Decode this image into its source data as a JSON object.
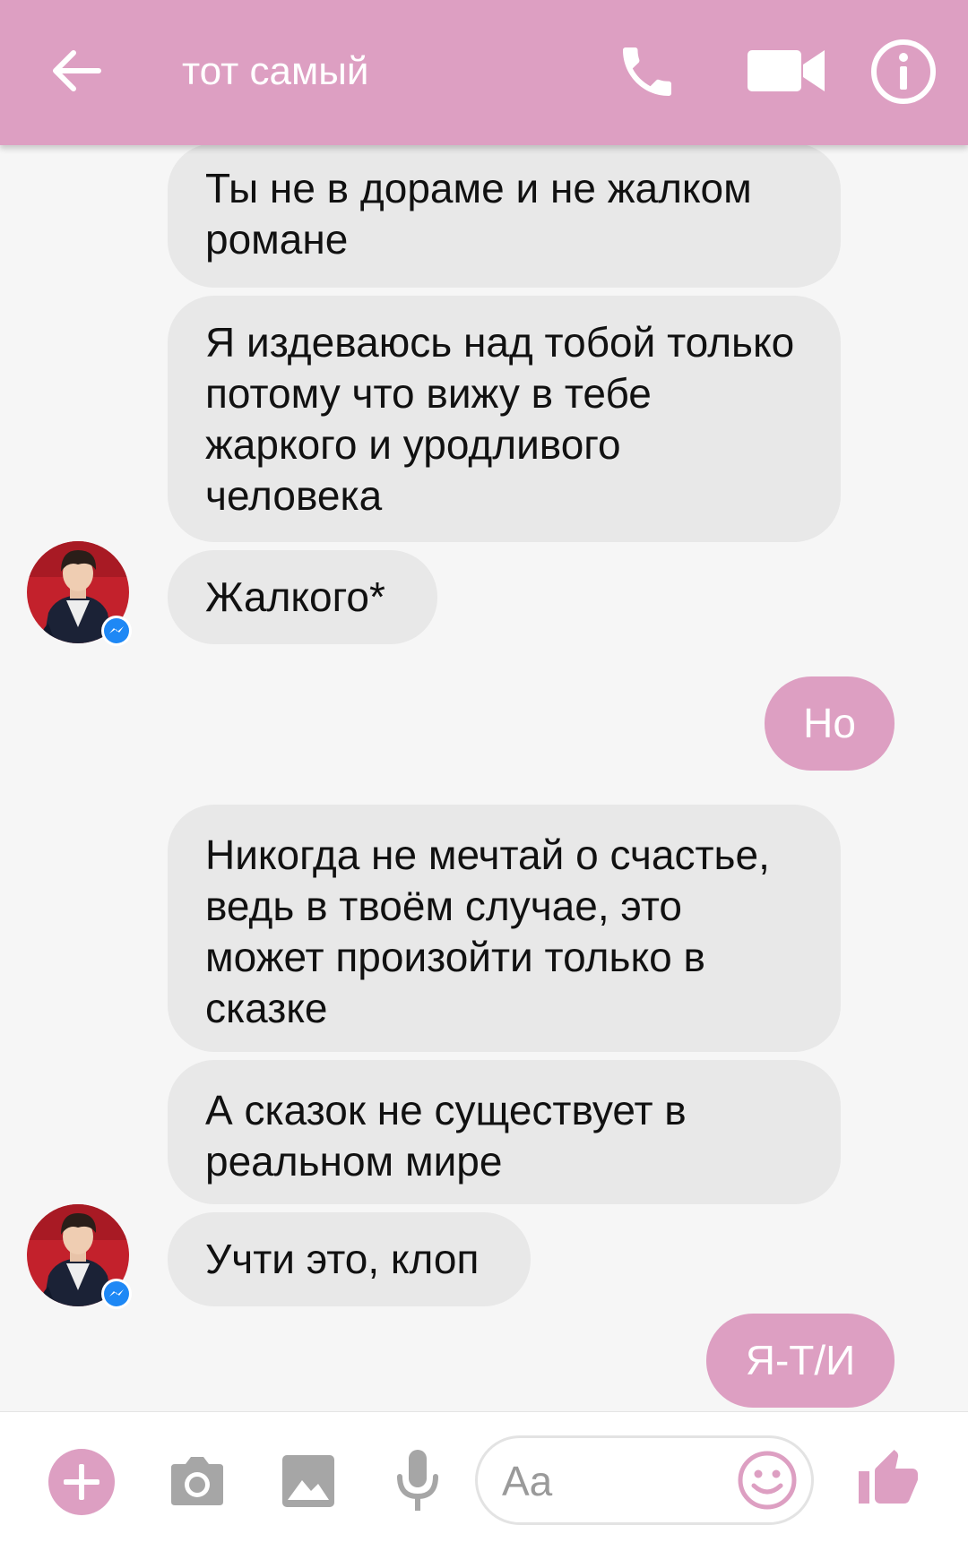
{
  "theme": {
    "accent": "#dd9fc2",
    "incoming_bubble": "#e8e8e8",
    "messenger_badge": "#1e88f5"
  },
  "header": {
    "title": "тот самый",
    "icons": [
      "back-arrow-icon",
      "phone-icon",
      "video-camera-icon",
      "info-icon"
    ]
  },
  "messages": [
    {
      "from": "contact",
      "text": "Ты не в дораме и не жалком романе"
    },
    {
      "from": "contact",
      "text": "Я издеваюсь над тобой только потому что вижу в тебе жаркого и уродливого человека"
    },
    {
      "from": "contact",
      "text": "Жалкого*"
    },
    {
      "from": "me",
      "text": "Но"
    },
    {
      "from": "contact",
      "text": "Никогда не мечтай о счастье, ведь в твоём случае, это может произойти только в сказке"
    },
    {
      "from": "contact",
      "text": "А сказок не существует в реальном мире"
    },
    {
      "from": "contact",
      "text": "Учти это, клоп"
    },
    {
      "from": "me",
      "text": "Я-Т/И"
    }
  ],
  "composer": {
    "placeholder": "Aa",
    "icons": [
      "plus-icon",
      "camera-icon",
      "image-icon",
      "microphone-icon",
      "emoji-icon",
      "thumbs-up-icon"
    ]
  }
}
